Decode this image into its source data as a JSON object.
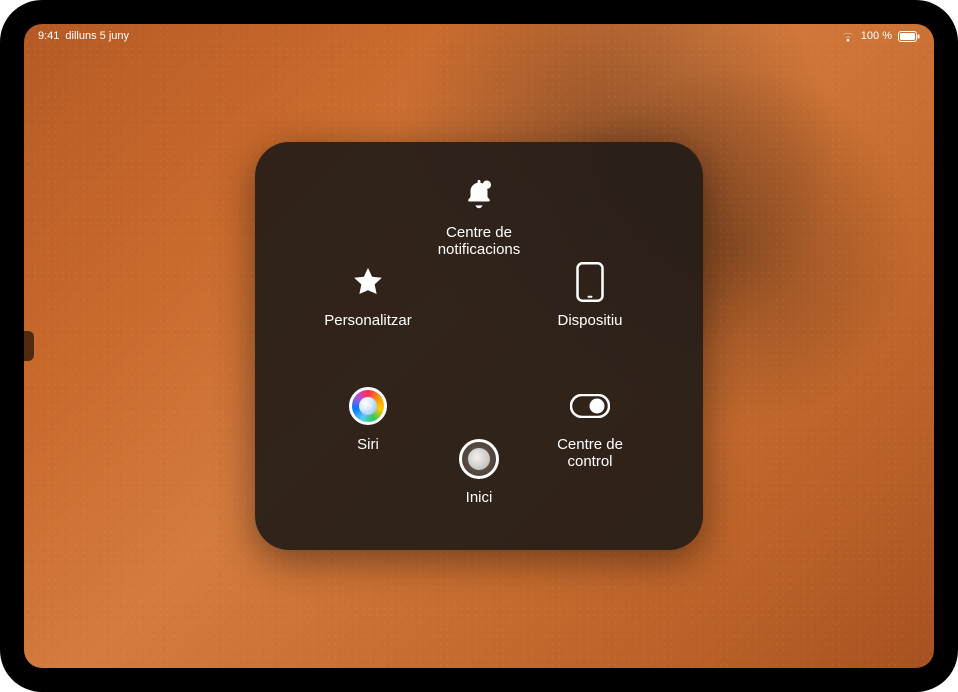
{
  "status_bar": {
    "time": "9:41",
    "date": "dilluns 5 juny",
    "battery_text": "100 %",
    "wifi_icon": "wifi-icon",
    "battery_icon": "battery-full-icon"
  },
  "assistive_touch": {
    "items": {
      "top": {
        "label": "Centre de\nnotificacions",
        "icon": "bell-badge-icon"
      },
      "tl": {
        "label": "Personalitzar",
        "icon": "star-icon"
      },
      "tr": {
        "label": "Dispositiu",
        "icon": "ipad-icon"
      },
      "bl": {
        "label": "Siri",
        "icon": "siri-icon"
      },
      "br": {
        "label": "Centre de\ncontrol",
        "icon": "toggle-icon"
      },
      "bottom": {
        "label": "Inici",
        "icon": "home-button-icon"
      }
    }
  }
}
